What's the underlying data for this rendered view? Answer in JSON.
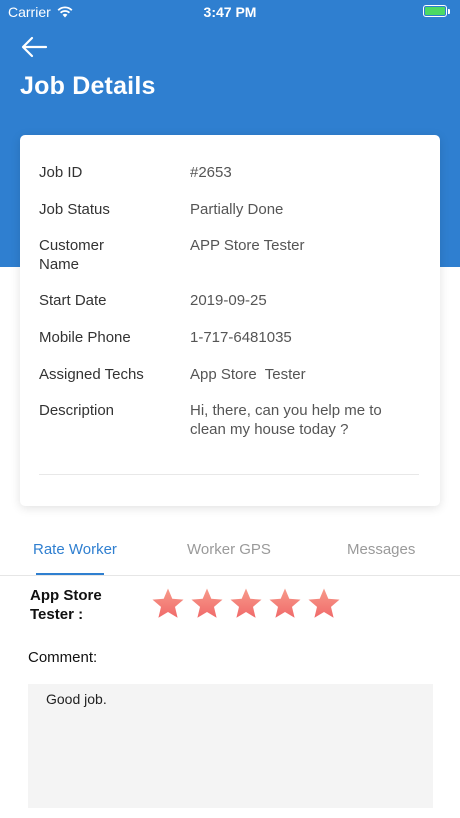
{
  "status_bar": {
    "carrier": "Carrier",
    "time": "3:47 PM"
  },
  "header": {
    "title": "Job Details",
    "color": "#2f7fd0"
  },
  "job": {
    "rows": [
      {
        "label": "Job ID",
        "value": "#2653"
      },
      {
        "label": "Job Status",
        "value": "Partially Done"
      },
      {
        "label": "Customer Name",
        "value": "APP Store Tester"
      },
      {
        "label": "Start Date",
        "value": "2019-09-25"
      },
      {
        "label": "Mobile Phone",
        "value": "1-717-6481035"
      },
      {
        "label": "Assigned Techs",
        "value": "App Store  Tester"
      },
      {
        "label": "Description",
        "value": "Hi, there, can you help me to clean my house today ?"
      }
    ]
  },
  "tabs": [
    {
      "label": "Rate Worker",
      "active": true
    },
    {
      "label": "Worker GPS",
      "active": false
    },
    {
      "label": "Messages",
      "active": false
    }
  ],
  "rating": {
    "worker_name": "App Store Tester :",
    "stars": 5,
    "max_stars": 5,
    "star_color": "#f06a6a"
  },
  "comment": {
    "label": "Comment:",
    "value": "Good job."
  }
}
